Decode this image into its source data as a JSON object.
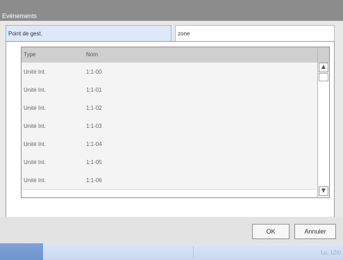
{
  "window": {
    "title": "Evénements"
  },
  "tabs": [
    {
      "label": "Point de gest.",
      "active": true
    },
    {
      "label": "zone",
      "active": false
    }
  ],
  "table": {
    "columns": [
      "Type",
      "Nom"
    ],
    "rows": [
      {
        "type": "Unité Int.",
        "name": "1:1-00"
      },
      {
        "type": "Unité Int.",
        "name": "1:1-01"
      },
      {
        "type": "Unité Int.",
        "name": "1:1-02"
      },
      {
        "type": "Unité Int.",
        "name": "1:1-03"
      },
      {
        "type": "Unité Int.",
        "name": "1:1-04"
      },
      {
        "type": "Unité Int.",
        "name": "1:1-05"
      },
      {
        "type": "Unité Int.",
        "name": "1:1-06"
      }
    ]
  },
  "buttons": {
    "ok": "OK",
    "cancel": "Annuler"
  },
  "taskbar": {
    "clock": "Lu, 12/0"
  },
  "icons": {
    "scroll_up": "up-arrow-icon",
    "scroll_down": "down-arrow-icon"
  },
  "colors": {
    "title_bar": "#8c8c8c",
    "active_tab": "#dde8fb",
    "taskbar_start": "#7fa3d8"
  }
}
